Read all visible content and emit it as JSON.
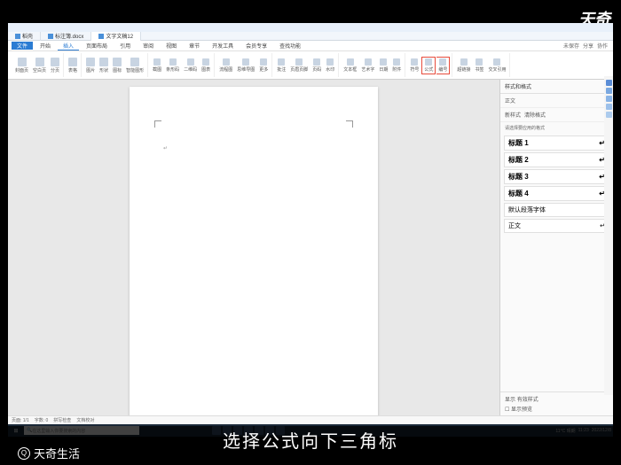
{
  "watermark_top": "天奇",
  "bottom_logo": "天奇生活",
  "caption": "选择公式向下三角标",
  "tabs": [
    {
      "label": "稻壳",
      "icon": true
    },
    {
      "label": "标注簿.docx",
      "icon": true,
      "active": false
    },
    {
      "label": "文字文稿12",
      "icon": true,
      "active": true
    }
  ],
  "ribbon_tabs": {
    "file": "文件",
    "items": [
      "开始",
      "插入",
      "页面布局",
      "引用",
      "审阅",
      "视图",
      "章节",
      "开发工具",
      "会员专享"
    ],
    "active_index": 1,
    "search": "查找功能"
  },
  "ribbon_right": {
    "undo": "未保存",
    "share": "分享",
    "collab": "协作"
  },
  "ribbon_buttons": {
    "g1": [
      "封面页",
      "空白页",
      "分页"
    ],
    "g2": [
      "表格"
    ],
    "g3": [
      "图片",
      "形状",
      "图标",
      "智能图形"
    ],
    "g4": [
      "截图",
      "条形码",
      "二维码",
      "图表"
    ],
    "g5": [
      "流程图",
      "思维导图",
      "更多"
    ],
    "g6": [
      "批注",
      "页眉页脚",
      "页码",
      "水印"
    ],
    "g7": [
      "文本框",
      "艺术字",
      "日期",
      "附件"
    ],
    "g8": [
      "符号",
      "公式",
      "编号"
    ],
    "g9": [
      "超链接",
      "书签",
      "交叉引用"
    ],
    "highlighted": "公式"
  },
  "side_panel": {
    "title": "样式和格式",
    "tab1": "正文",
    "sub1": "新样式",
    "sub2": "清除格式",
    "hint": "请选择要应用的格式",
    "styles": [
      "标题 1",
      "标题 2",
      "标题 3",
      "标题 4",
      "默认段落字体",
      "正文"
    ],
    "bottom_label": "显示",
    "bottom_value": "有效样式",
    "bottom_check": "显示预览"
  },
  "status_bar": {
    "page": "页面: 1/1",
    "words": "字数: 0",
    "spell": "拼写检查",
    "doc": "文档校对"
  },
  "taskbar": {
    "search_ph": "在这里输入你要搜索的内容",
    "time": "11:23",
    "date": "2022/12/8",
    "weather": "11°C 晴朗"
  }
}
